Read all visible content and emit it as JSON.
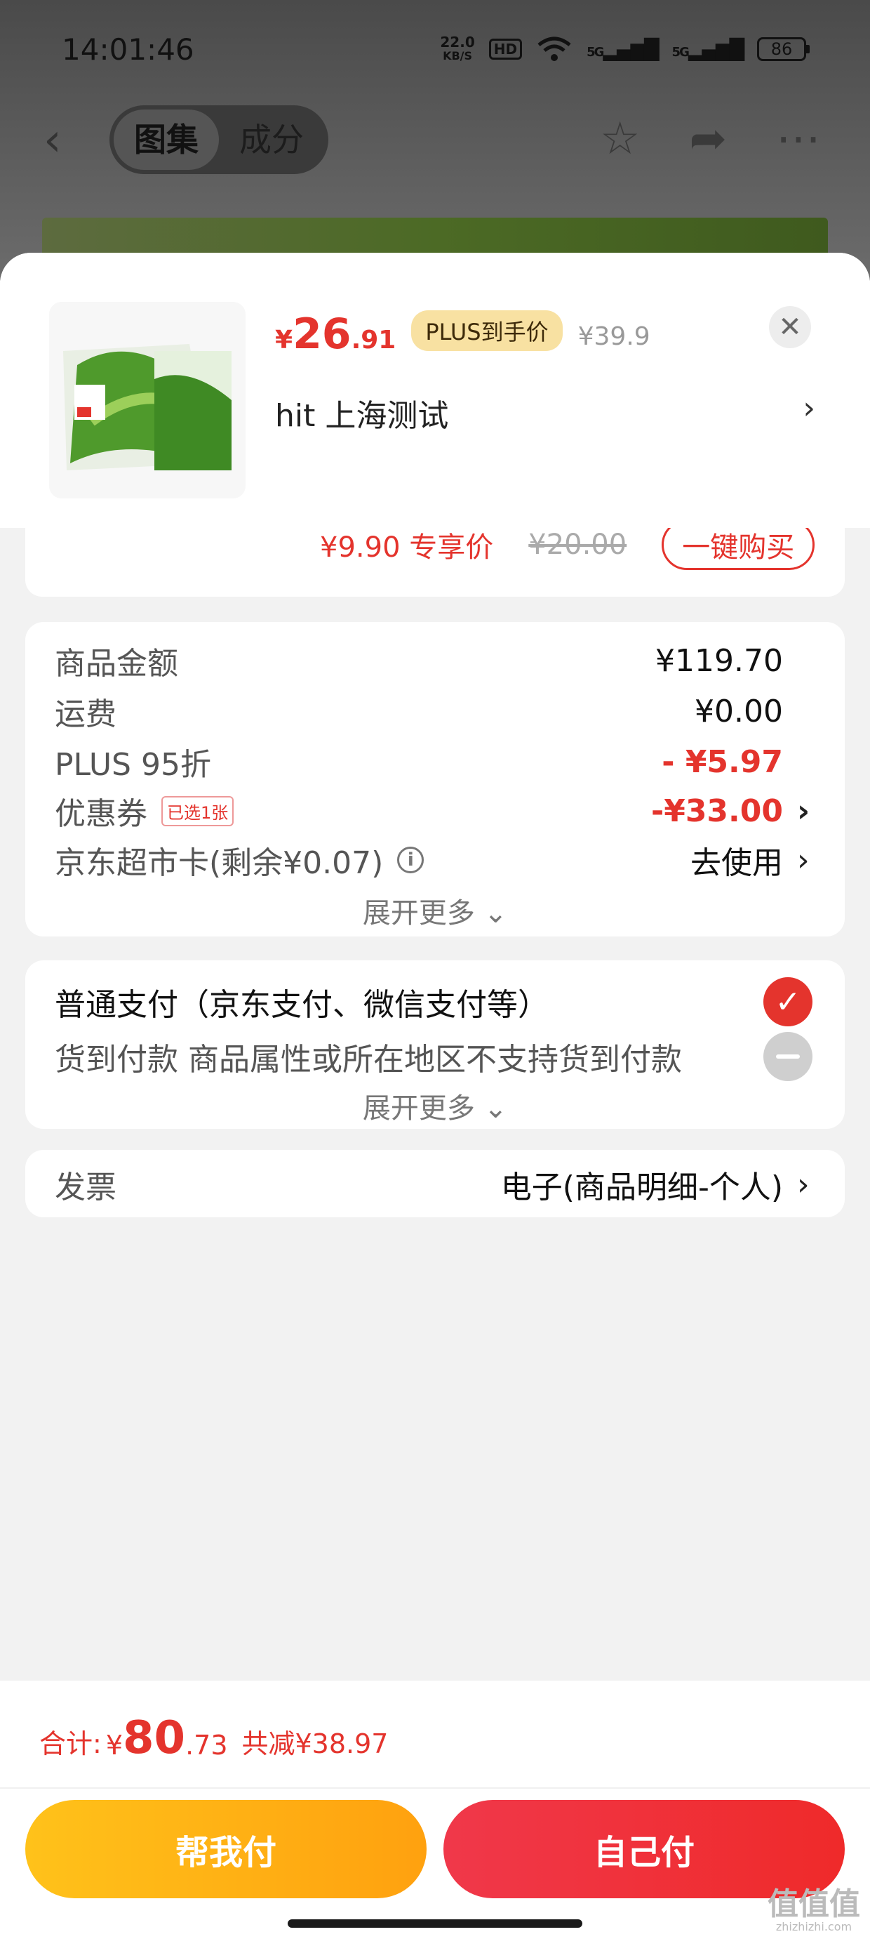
{
  "status_bar": {
    "time": "14:01:46",
    "net_speed_value": "22.0",
    "net_speed_unit": "KB/S",
    "hd_label": "HD",
    "signal_1": "5G",
    "signal_2": "5G",
    "battery": "86"
  },
  "nav": {
    "tabs": [
      {
        "label": "图集",
        "active": true
      },
      {
        "label": "成分",
        "active": false
      }
    ]
  },
  "sheet": {
    "product": {
      "price_symbol": "¥",
      "price_int": "26",
      "price_dec": ".91",
      "plus_badge": "PLUS到手价",
      "original_price": "¥39.9",
      "address": "hit  上海测试"
    },
    "partial_row": {
      "price": "¥9.90 专享价",
      "old_price": "¥20.00",
      "button": "一键购买"
    },
    "summary": {
      "rows": [
        {
          "label": "商品金额",
          "value": "¥119.70"
        },
        {
          "label": "运费",
          "value": "¥0.00"
        },
        {
          "label": "PLUS 95折",
          "value": "- ¥5.97"
        },
        {
          "label": "优惠券",
          "chip": "已选1张",
          "value": "-¥33.00"
        },
        {
          "label": "京东超市卡(剩余¥0.07)",
          "value": "去使用"
        }
      ],
      "expand_label": "展开更多 ⌄"
    },
    "payment": {
      "normal": "普通支付（京东支付、微信支付等）",
      "cod": "货到付款 商品属性或所在地区不支持货到付款",
      "expand_label": "展开更多 ⌄"
    },
    "invoice": {
      "label": "发票",
      "value": "电子(商品明细-个人)"
    }
  },
  "footer": {
    "total_label": "合计:",
    "total_symbol": "¥",
    "total_int": "80",
    "total_dec": ".73",
    "total_saved": "共减¥38.97",
    "help_pay": "帮我付",
    "self_pay": "自己付",
    "watermark": "值值值",
    "watermark_site": "zhizhizhi.com"
  },
  "colors": {
    "accent_red": "#e4342d",
    "help_button": "#ffb414",
    "self_button": "#ef2f3c",
    "plus_badge_bg": "#f8e1a2"
  }
}
